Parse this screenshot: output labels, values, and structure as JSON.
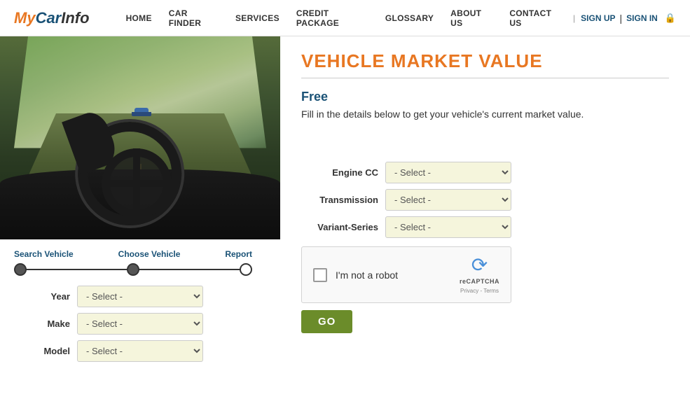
{
  "logo": {
    "my": "My",
    "car": "Car",
    "info": "Info"
  },
  "nav": {
    "items": [
      {
        "label": "HOME",
        "id": "home"
      },
      {
        "label": "CAR FINDER",
        "id": "car-finder"
      },
      {
        "label": "SERVICES",
        "id": "services"
      },
      {
        "label": "CREDIT PACKAGE",
        "id": "credit-package"
      },
      {
        "label": "GLOSSARY",
        "id": "glossary"
      },
      {
        "label": "ABOUT US",
        "id": "about-us"
      },
      {
        "label": "CONTACT US",
        "id": "contact-us"
      }
    ],
    "signup": "SIGN UP",
    "signin": "SIGN IN"
  },
  "page": {
    "title": "VEHICLE MARKET VALUE",
    "free_label": "Free",
    "description": "Fill in the details below to get your vehicle's current market value."
  },
  "steps": {
    "step1": "Search Vehicle",
    "step2": "Choose Vehicle",
    "step3": "Report"
  },
  "form": {
    "left": [
      {
        "label": "Year",
        "id": "year",
        "default": "- Select -"
      },
      {
        "label": "Make",
        "id": "make",
        "default": "- Select -"
      },
      {
        "label": "Model",
        "id": "model",
        "default": "- Select -"
      }
    ],
    "right": [
      {
        "label": "Engine CC",
        "id": "engine-cc",
        "default": "- Select -"
      },
      {
        "label": "Transmission",
        "id": "transmission",
        "default": "- Select -"
      },
      {
        "label": "Variant-Series",
        "id": "variant-series",
        "default": "- Select -"
      }
    ]
  },
  "captcha": {
    "text": "I'm not a robot",
    "brand": "reCAPTCHA",
    "links": "Privacy - Terms"
  },
  "buttons": {
    "go": "GO"
  }
}
